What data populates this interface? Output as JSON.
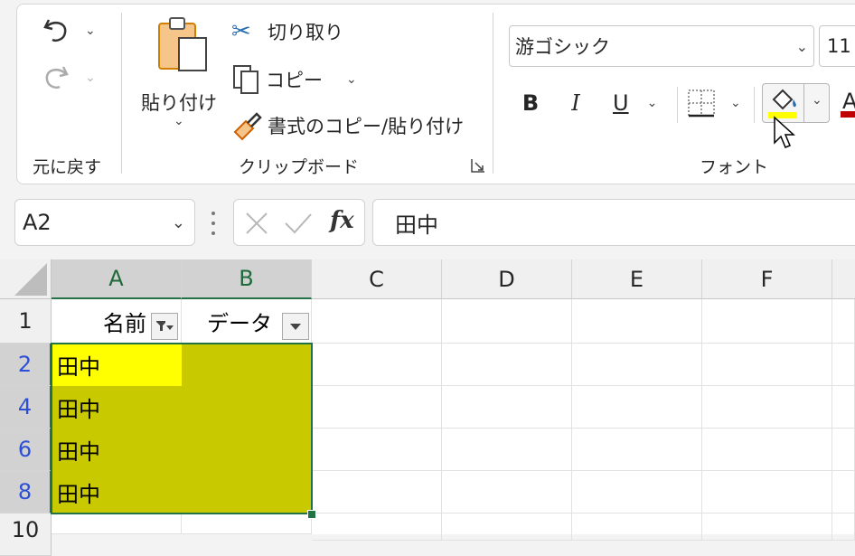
{
  "ribbon": {
    "undo_group_label": "元に戻す",
    "clipboard": {
      "paste_label": "貼り付け",
      "cut_label": "切り取り",
      "copy_label": "コピー",
      "format_painter_label": "書式のコピー/貼り付け",
      "group_label": "クリップボード"
    },
    "font": {
      "font_name": "游ゴシック",
      "font_size": "11",
      "bold": "B",
      "italic": "I",
      "underline": "U",
      "font_color_glyph": "A",
      "group_label": "フォント",
      "fill_color": "#ffff00",
      "font_color": "#c00000"
    }
  },
  "formula_bar": {
    "name_box": "A2",
    "fx_label": "fx",
    "content": "田中"
  },
  "sheet": {
    "columns": [
      "A",
      "B",
      "C",
      "D",
      "E",
      "F"
    ],
    "header_row": {
      "row": "1",
      "a": "名前",
      "b": "データ"
    },
    "rows": [
      {
        "row": "2",
        "a": "田中"
      },
      {
        "row": "4",
        "a": "田中"
      },
      {
        "row": "6",
        "a": "田中"
      },
      {
        "row": "8",
        "a": "田中"
      }
    ],
    "next_row": "10",
    "selection_fill": "#c9c900",
    "active_cell_fill": "#ffff00"
  }
}
